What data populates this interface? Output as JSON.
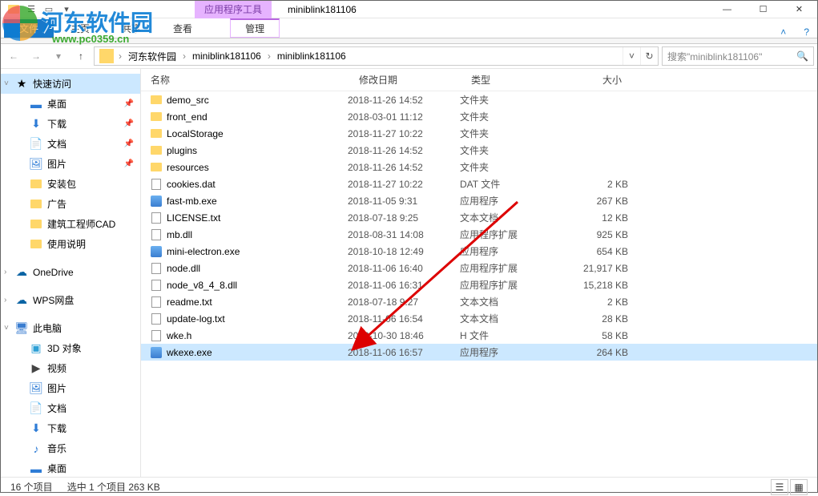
{
  "titlebar": {
    "tools_label": "应用程序工具",
    "title": "miniblink181106"
  },
  "ribbon": {
    "file": "文件",
    "home": "主页",
    "share": "共享",
    "view": "查看",
    "manage": "管理"
  },
  "breadcrumb": {
    "seg1": "河东软件园",
    "seg2": "miniblink181106",
    "seg3": "miniblink181106"
  },
  "search": {
    "placeholder": "搜索\"miniblink181106\""
  },
  "sidebar": {
    "quick": "快速访问",
    "desktop": "桌面",
    "downloads": "下载",
    "documents": "文档",
    "pictures": "图片",
    "install": "安装包",
    "ads": "广告",
    "cad": "建筑工程师CAD",
    "usage": "使用说明",
    "onedrive": "OneDrive",
    "wps": "WPS网盘",
    "thispc": "此电脑",
    "obj3d": "3D 对象",
    "videos": "视频",
    "pictures2": "图片",
    "documents2": "文档",
    "downloads2": "下载",
    "music": "音乐",
    "desktop2": "桌面"
  },
  "columns": {
    "name": "名称",
    "date": "修改日期",
    "type": "类型",
    "size": "大小"
  },
  "files": [
    {
      "icon": "folder",
      "name": "demo_src",
      "date": "2018-11-26 14:52",
      "type": "文件夹",
      "size": ""
    },
    {
      "icon": "folder",
      "name": "front_end",
      "date": "2018-03-01 11:12",
      "type": "文件夹",
      "size": ""
    },
    {
      "icon": "folder",
      "name": "LocalStorage",
      "date": "2018-11-27 10:22",
      "type": "文件夹",
      "size": ""
    },
    {
      "icon": "folder",
      "name": "plugins",
      "date": "2018-11-26 14:52",
      "type": "文件夹",
      "size": ""
    },
    {
      "icon": "folder",
      "name": "resources",
      "date": "2018-11-26 14:52",
      "type": "文件夹",
      "size": ""
    },
    {
      "icon": "file",
      "name": "cookies.dat",
      "date": "2018-11-27 10:22",
      "type": "DAT 文件",
      "size": "2 KB"
    },
    {
      "icon": "exe",
      "name": "fast-mb.exe",
      "date": "2018-11-05 9:31",
      "type": "应用程序",
      "size": "267 KB"
    },
    {
      "icon": "file",
      "name": "LICENSE.txt",
      "date": "2018-07-18 9:25",
      "type": "文本文档",
      "size": "12 KB"
    },
    {
      "icon": "file",
      "name": "mb.dll",
      "date": "2018-08-31 14:08",
      "type": "应用程序扩展",
      "size": "925 KB"
    },
    {
      "icon": "exe",
      "name": "mini-electron.exe",
      "date": "2018-10-18 12:49",
      "type": "应用程序",
      "size": "654 KB"
    },
    {
      "icon": "file",
      "name": "node.dll",
      "date": "2018-11-06 16:40",
      "type": "应用程序扩展",
      "size": "21,917 KB"
    },
    {
      "icon": "file",
      "name": "node_v8_4_8.dll",
      "date": "2018-11-06 16:31",
      "type": "应用程序扩展",
      "size": "15,218 KB"
    },
    {
      "icon": "file",
      "name": "readme.txt",
      "date": "2018-07-18 9:27",
      "type": "文本文档",
      "size": "2 KB"
    },
    {
      "icon": "file",
      "name": "update-log.txt",
      "date": "2018-11-06 16:54",
      "type": "文本文档",
      "size": "28 KB"
    },
    {
      "icon": "file",
      "name": "wke.h",
      "date": "2018-10-30 18:46",
      "type": "H 文件",
      "size": "58 KB"
    },
    {
      "icon": "exe",
      "name": "wkexe.exe",
      "date": "2018-11-06 16:57",
      "type": "应用程序",
      "size": "264 KB",
      "selected": true
    }
  ],
  "status": {
    "count": "16 个项目",
    "selected": "选中 1 个项目  263 KB"
  },
  "watermark": {
    "site": "河东软件园",
    "url": "www.pc0359.cn"
  }
}
